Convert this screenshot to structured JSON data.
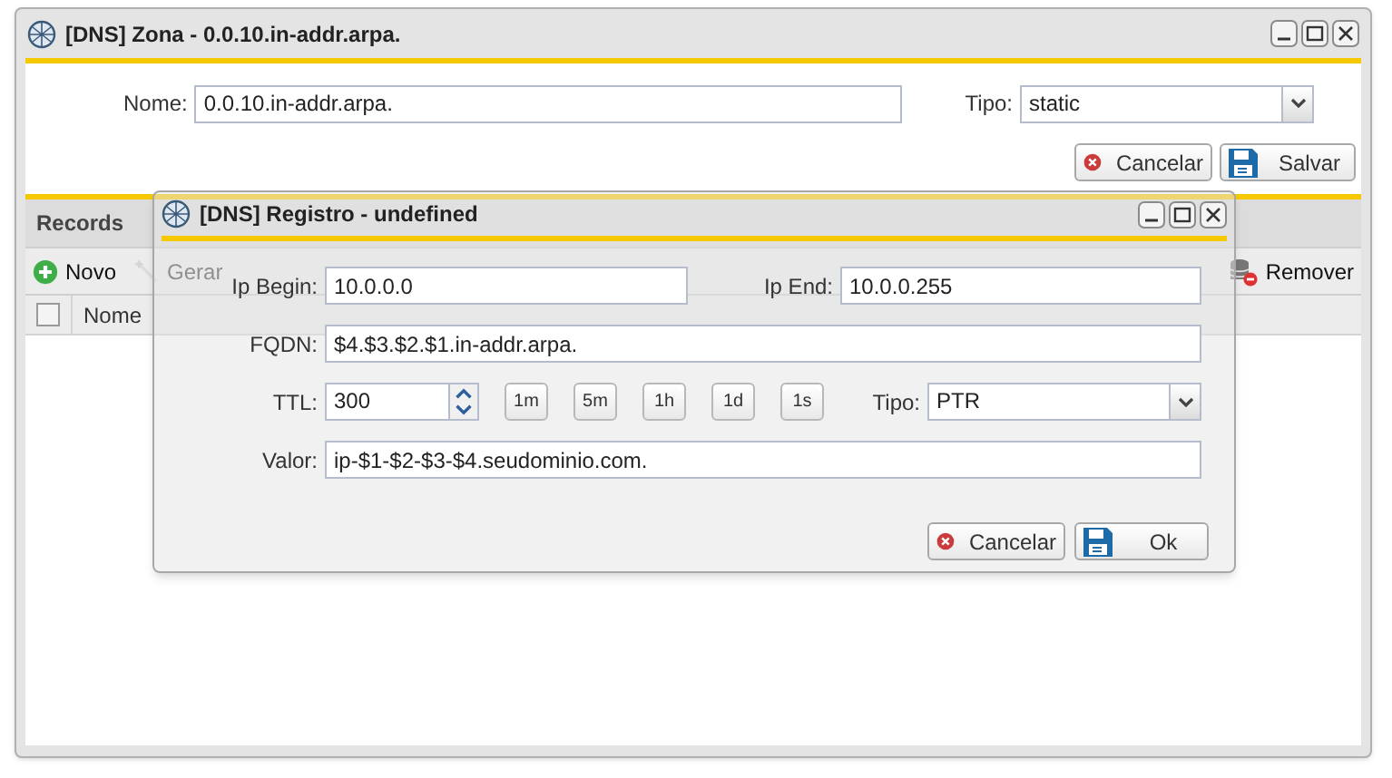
{
  "zone_window": {
    "title": "[DNS] Zona - 0.0.10.in-addr.arpa.",
    "nome_label": "Nome:",
    "nome_value": "0.0.10.in-addr.arpa.",
    "tipo_label": "Tipo:",
    "tipo_value": "static",
    "buttons": [
      {
        "kind": "cancel",
        "label": "Cancelar"
      },
      {
        "kind": "save",
        "label": "Salvar"
      }
    ]
  },
  "records": {
    "title": "Records",
    "select_all_checked": false,
    "columns": [
      "Nome"
    ],
    "toolbar": [
      {
        "kind": "add",
        "label": "Novo",
        "disabled": false
      },
      {
        "kind": "generate",
        "label": "Gerar",
        "disabled": true
      },
      {
        "kind": "remove",
        "label": "Remover",
        "disabled": false
      }
    ]
  },
  "dialog": {
    "title": "[DNS] Registro - undefined",
    "ip_begin_label": "Ip Begin:",
    "ip_begin": "10.0.0.0",
    "ip_end_label": "Ip End:",
    "ip_end": "10.0.0.255",
    "fqdn_label": "FQDN:",
    "fqdn": "$4.$3.$2.$1.in-addr.arpa.",
    "ttl_label": "TTL:",
    "ttl": "300",
    "ttl_presets": [
      "1m",
      "5m",
      "1h",
      "1d",
      "1s"
    ],
    "tipo_label": "Tipo:",
    "tipo": "PTR",
    "valor_label": "Valor:",
    "valor": "ip-$1-$2-$3-$4.seudominio.com.",
    "buttons": [
      {
        "kind": "cancel",
        "label": "Cancelar"
      },
      {
        "kind": "save",
        "label": "Ok"
      }
    ]
  }
}
